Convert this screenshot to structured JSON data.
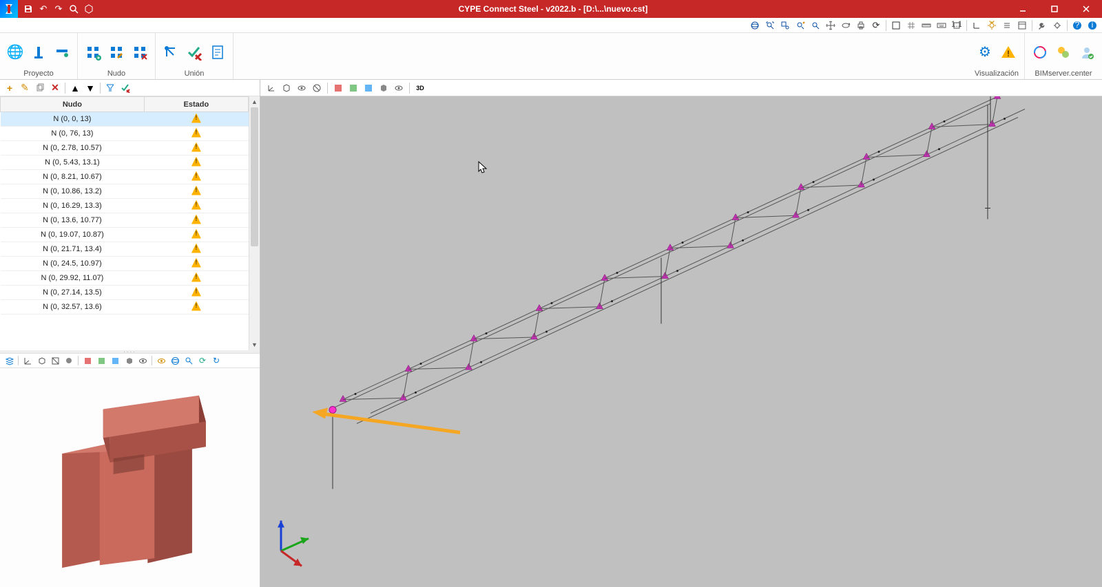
{
  "title": "CYPE Connect Steel - v2022.b - [D:\\...\\nuevo.cst]",
  "ribbon": {
    "groups": {
      "proyecto": "Proyecto",
      "nudo": "Nudo",
      "union": "Unión",
      "visualizacion": "Visualización",
      "bim": "BIMserver.center"
    }
  },
  "table": {
    "headers": {
      "nudo": "Nudo",
      "estado": "Estado"
    },
    "rows": [
      {
        "name": "N (0, 0, 13)",
        "status": "warn",
        "selected": true
      },
      {
        "name": "N (0, 76, 13)",
        "status": "warn"
      },
      {
        "name": "N (0, 2.78, 10.57)",
        "status": "warn"
      },
      {
        "name": "N (0, 5.43, 13.1)",
        "status": "warn"
      },
      {
        "name": "N (0, 8.21, 10.67)",
        "status": "warn"
      },
      {
        "name": "N (0, 10.86, 13.2)",
        "status": "warn"
      },
      {
        "name": "N (0, 16.29, 13.3)",
        "status": "warn"
      },
      {
        "name": "N (0, 13.6, 10.77)",
        "status": "warn"
      },
      {
        "name": "N (0, 19.07, 10.87)",
        "status": "warn"
      },
      {
        "name": "N (0, 21.71, 13.4)",
        "status": "warn"
      },
      {
        "name": "N (0, 24.5, 10.97)",
        "status": "warn"
      },
      {
        "name": "N (0, 29.92, 11.07)",
        "status": "warn"
      },
      {
        "name": "N (0, 27.14, 13.5)",
        "status": "warn"
      },
      {
        "name": "N (0, 32.57, 13.6)",
        "status": "warn"
      }
    ]
  },
  "icons": {
    "save": "save",
    "undo": "undo",
    "redo": "redo",
    "search": "search",
    "cube": "cube",
    "minimize": "min",
    "maximize": "max",
    "close": "close"
  }
}
